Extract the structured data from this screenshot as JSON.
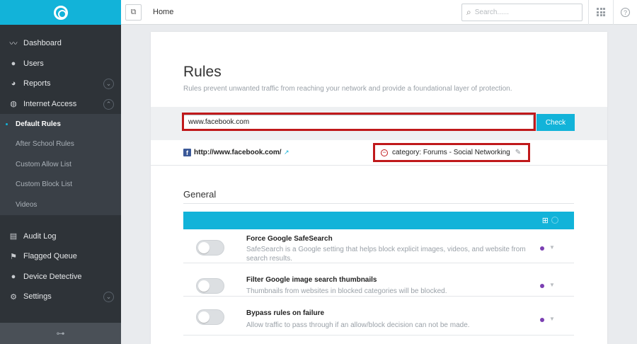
{
  "sidebar": {
    "main_items": [
      {
        "label": "Dashboard",
        "icon": "activity-icon"
      },
      {
        "label": "Users",
        "icon": "user-icon"
      },
      {
        "label": "Reports",
        "icon": "pie-chart-icon"
      },
      {
        "label": "Internet Access",
        "icon": "globe-icon"
      }
    ],
    "sub_items": [
      {
        "label": "Default Rules",
        "active": true
      },
      {
        "label": "After School Rules"
      },
      {
        "label": "Custom Allow List"
      },
      {
        "label": "Custom Block List"
      },
      {
        "label": "Videos"
      }
    ],
    "secondary_items": [
      {
        "label": "Audit Log",
        "icon": "list-icon"
      },
      {
        "label": "Flagged Queue",
        "icon": "flag-icon"
      },
      {
        "label": "Device Detective",
        "icon": "user-icon"
      },
      {
        "label": "Settings",
        "icon": "gear-icon"
      }
    ]
  },
  "topbar": {
    "breadcrumb": "Home",
    "search_placeholder": "Search......"
  },
  "page": {
    "title": "Rules",
    "subtitle": "Rules prevent unwanted traffic from reaching your network and provide a foundational layer of protection."
  },
  "checker": {
    "url_value": "www.facebook.com",
    "check_label": "Check",
    "result_url": "http://www.facebook.com/",
    "category_text": "category: Forums - Social Networking"
  },
  "general": {
    "heading": "General",
    "rows": [
      {
        "title": "Force Google SafeSearch",
        "description": "SafeSearch is a Google setting that helps block explicit images, videos, and website from search results."
      },
      {
        "title": "Filter Google image search thumbnails",
        "description": "Thumbnails from websites in blocked categories will be blocked."
      },
      {
        "title": "Bypass rules on failure",
        "description": "Allow traffic to pass through if an allow/block decision can not be made."
      }
    ]
  },
  "colors": {
    "accent": "#12b3d9",
    "sidebar_bg": "#2e3338",
    "highlight": "#c0191b",
    "status_dot": "#7b3fb2"
  }
}
